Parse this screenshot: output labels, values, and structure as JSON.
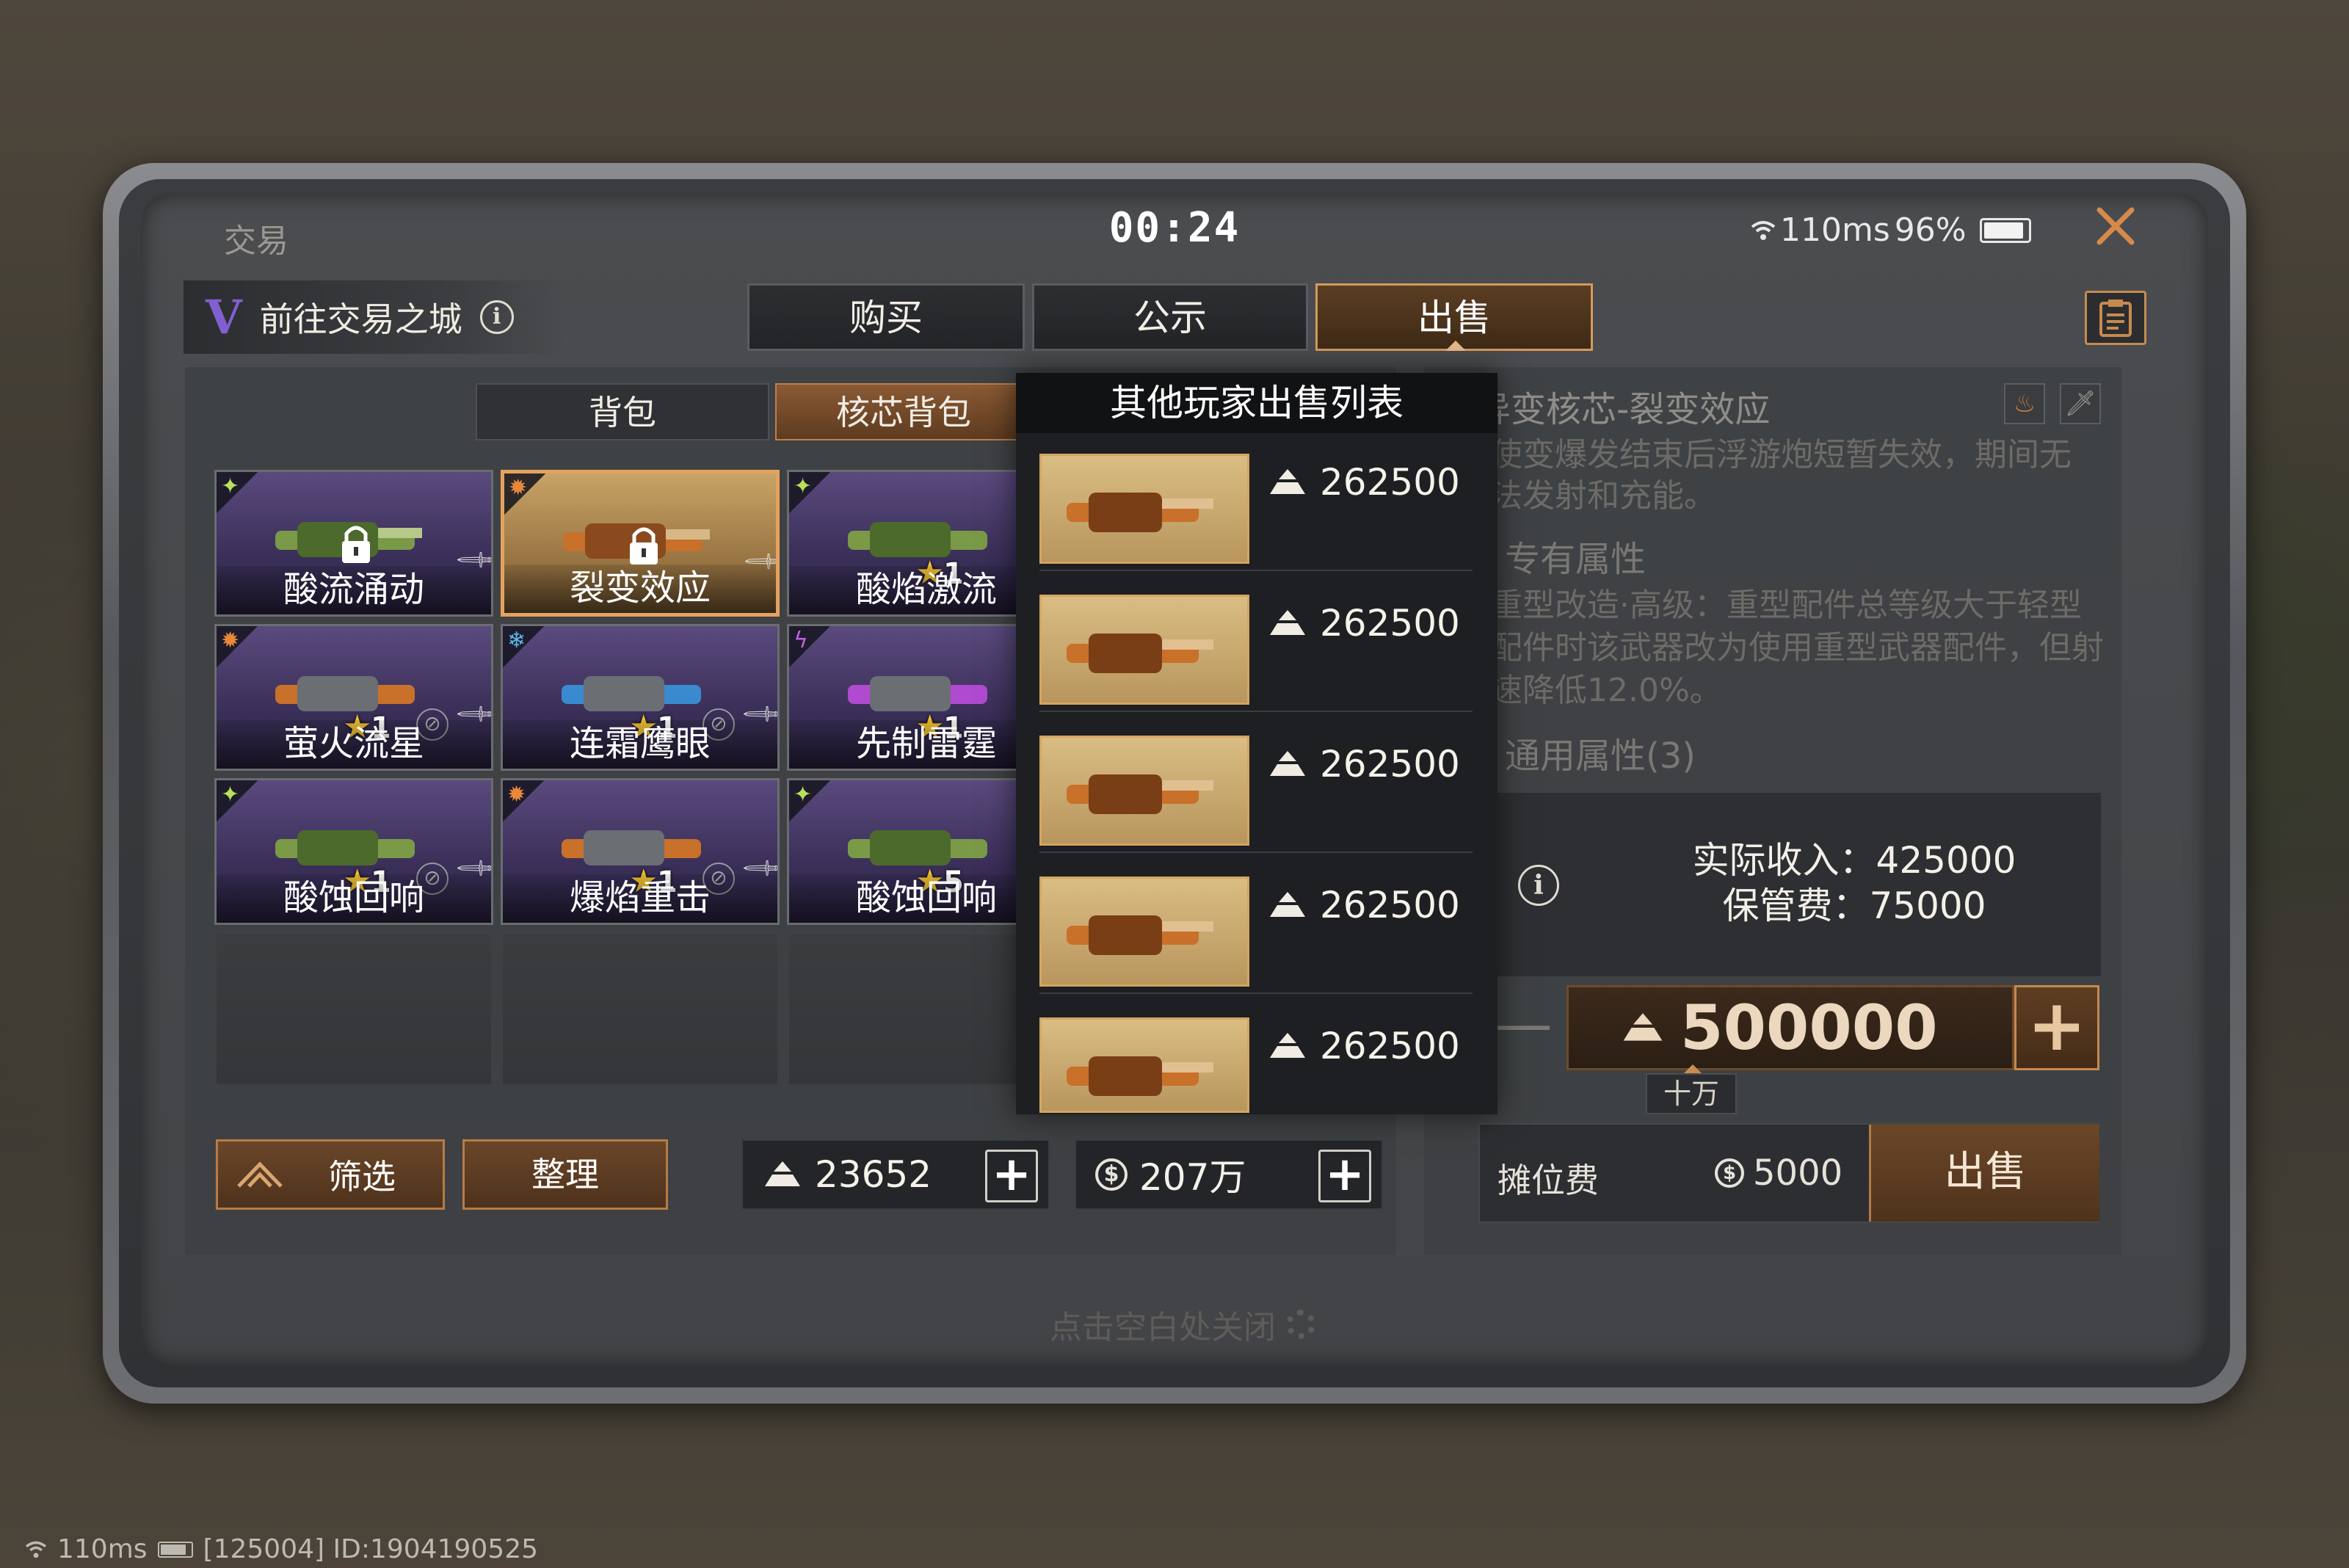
{
  "window": {
    "title": "交易",
    "timer": "00:24",
    "network": "110ms",
    "battery_percent": "96%"
  },
  "header": {
    "city_link": "前往交易之城",
    "tabs": [
      {
        "label": "购买",
        "active": false
      },
      {
        "label": "公示",
        "active": false
      },
      {
        "label": "出售",
        "active": true
      }
    ]
  },
  "inventory": {
    "subtabs": [
      {
        "label": "背包",
        "active": false
      },
      {
        "label": "核芯背包",
        "active": true
      }
    ],
    "items": [
      {
        "name": "酸流涌动",
        "rarity": "purple",
        "locked": true,
        "count": ""
      },
      {
        "name": "裂变效应",
        "rarity": "gold",
        "locked": true,
        "count": "",
        "selected": true
      },
      {
        "name": "酸焰激流",
        "rarity": "purple",
        "locked": false,
        "count": "1"
      },
      {
        "name": "萤火流星",
        "rarity": "purple",
        "locked": false,
        "count": "1"
      },
      {
        "name": "连霜鹰眼",
        "rarity": "purple",
        "locked": false,
        "count": "1"
      },
      {
        "name": "先制雷霆",
        "rarity": "purple",
        "locked": false,
        "count": "1"
      },
      {
        "name": "酸蚀回响",
        "rarity": "purple",
        "locked": false,
        "count": "1"
      },
      {
        "name": "爆焰重击",
        "rarity": "purple",
        "locked": false,
        "count": "1"
      },
      {
        "name": "酸蚀回响",
        "rarity": "purple",
        "locked": false,
        "count": "5"
      }
    ],
    "filter_label": "筛选",
    "sort_label": "整理"
  },
  "currency": {
    "gold": "23652",
    "coins": "207万"
  },
  "detail": {
    "title": "异变核芯-裂变效应",
    "desc": "使变爆发结束后浮游炮短暂失效，期间无法发射和充能。",
    "section_exclusive": "专有属性",
    "exclusive_text": "重型改造·高级：重型配件总等级大于轻型配件时该武器改为使用重型武器配件，但射速降低12.0%。",
    "section_general": "通用属性(3)"
  },
  "sale": {
    "actual_income_label": "实际收入：425000",
    "storage_fee_label": "保管费：75000",
    "price": "500000",
    "price_unit": "十万",
    "stall_fee_label": "摊位费",
    "stall_fee": "5000",
    "sell_button": "出售"
  },
  "market_list": {
    "title": "其他玩家出售列表",
    "listings": [
      {
        "price": "262500"
      },
      {
        "price": "262500"
      },
      {
        "price": "262500"
      },
      {
        "price": "262500"
      },
      {
        "price": "262500"
      }
    ]
  },
  "close_hint": "点击空白处关闭",
  "footer": {
    "latency": "110ms",
    "id_text": "[125004] ID:1904190525"
  },
  "colors": {
    "accent": "#c68a4e",
    "purple_card": "#4a3d6e",
    "gold_card": "#c9a467"
  }
}
